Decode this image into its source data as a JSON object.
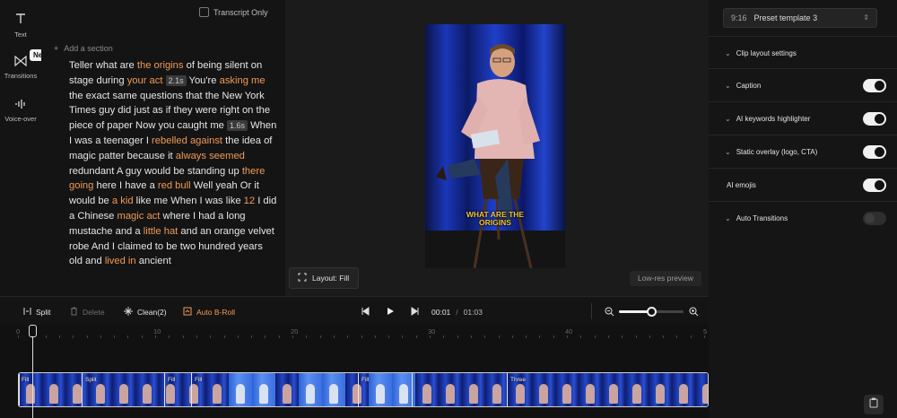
{
  "rail": {
    "text_label": "Text",
    "transitions_label": "Transitions",
    "voiceover_label": "Voice-over",
    "new_badge": "New"
  },
  "transcript": {
    "transcript_only_label": "Transcript Only",
    "add_section_label": "Add a section",
    "segments": [
      {
        "t": "Teller what are "
      },
      {
        "t": "the origins",
        "hl": true
      },
      {
        "t": " of being silent on stage during "
      },
      {
        "t": "your act",
        "hl": true
      },
      {
        "t": " "
      },
      {
        "t": "2.1s",
        "pause": true
      },
      {
        "t": " You're "
      },
      {
        "t": "asking me",
        "hl": true
      },
      {
        "t": " the exact same questions that the New York Times guy did just as if they were right on the piece of paper Now you caught me "
      },
      {
        "t": "1.6s",
        "pause": true
      },
      {
        "t": " When I was a teenager I "
      },
      {
        "t": "rebelled against",
        "hl": true
      },
      {
        "t": " the idea of magic patter because it "
      },
      {
        "t": "always seemed",
        "hl": true
      },
      {
        "t": " redundant A guy would be standing up "
      },
      {
        "t": "there going",
        "hl": true
      },
      {
        "t": " here I have a "
      },
      {
        "t": "red bull",
        "hl": true
      },
      {
        "t": " Well yeah Or it would be "
      },
      {
        "t": "a kid",
        "hl": true
      },
      {
        "t": " like me When I was like "
      },
      {
        "t": "12",
        "hl": true
      },
      {
        "t": " I did a Chinese "
      },
      {
        "t": "magic act",
        "hl": true
      },
      {
        "t": " where I had a long mustache and a "
      },
      {
        "t": "little hat",
        "hl": true
      },
      {
        "t": " and an orange velvet robe And I claimed to be two hundred years old and "
      },
      {
        "t": "lived in",
        "hl": true
      },
      {
        "t": " ancient"
      }
    ]
  },
  "preview": {
    "caption_line1": "WHAT ARE THE",
    "caption_line2": "ORIGINS",
    "layout_label": "Layout: Fill",
    "lowres_label": "Low-res preview"
  },
  "settings": {
    "preset_ratio": "9:16",
    "preset_name": "Preset template 3",
    "rows": [
      {
        "label": "Clip layout settings",
        "expandable": true,
        "toggle": null
      },
      {
        "label": "Caption",
        "expandable": true,
        "toggle": true
      },
      {
        "label": "AI keywords highlighter",
        "expandable": true,
        "toggle": true
      },
      {
        "label": "Static overlay (logo, CTA)",
        "expandable": true,
        "toggle": true
      },
      {
        "label": "AI emojis",
        "expandable": false,
        "toggle": true
      },
      {
        "label": "Auto Transitions",
        "expandable": true,
        "toggle": false
      }
    ]
  },
  "toolbar": {
    "split_label": "Split",
    "delete_label": "Delete",
    "clean_label": "Clean(2)",
    "broll_label": "Auto B-Roll",
    "current_time": "00:01",
    "separator": "/",
    "duration": "01:03",
    "zoom_level": 0.5
  },
  "timeline": {
    "ruler_labels": [
      "0",
      "10",
      "20",
      "30",
      "40",
      "5"
    ],
    "segments": [
      "Fill",
      "Split",
      "Fill",
      "Fill",
      "Fill",
      "Three"
    ]
  },
  "colors": {
    "accent": "#f19a56",
    "video_bg": "#0d1a4a",
    "caption": "#f0c341"
  }
}
